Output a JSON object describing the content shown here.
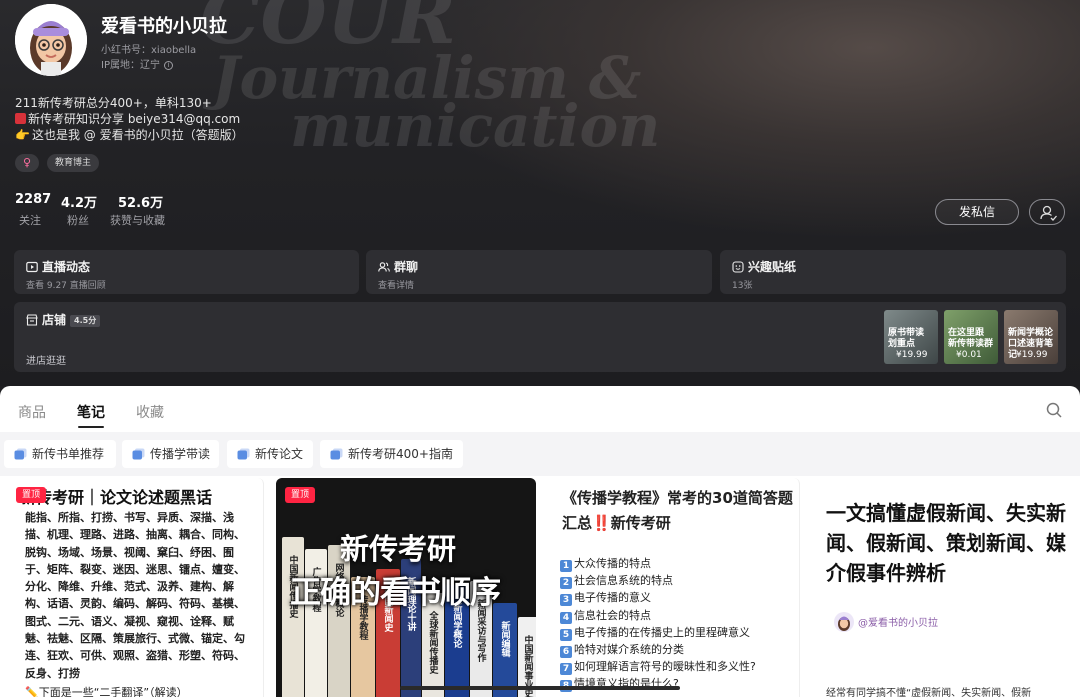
{
  "profile": {
    "name": "爱看书的小贝拉",
    "id_line": "小红书号：xiaobella",
    "ip_line": "IP属地：辽宁",
    "bio": [
      "211新传考研总分400+，单科130+",
      "新传考研知识分享 beiye314@qq.com",
      "这也是我 @ 爱看书的小贝拉（答题版）"
    ],
    "gender_symbol": "♀",
    "category_tag": "教育博主",
    "hero_text": [
      "COUR",
      "Journalism &",
      "munication"
    ]
  },
  "stats": [
    {
      "value": "2287",
      "label": "关注"
    },
    {
      "value": "4.2万",
      "label": "粉丝"
    },
    {
      "value": "52.6万",
      "label": "获赞与收藏"
    }
  ],
  "actions": {
    "message_label": "发私信"
  },
  "features": [
    {
      "title": "直播动态",
      "sub": "查看 9.27 直播回顾",
      "icon": "live-icon"
    },
    {
      "title": "群聊",
      "sub": "查看详情",
      "icon": "group-icon"
    },
    {
      "title": "兴趣贴纸",
      "sub": "13张",
      "icon": "sticker-icon"
    }
  ],
  "shop": {
    "title": "店铺",
    "rating": "4.5分",
    "enter": "进店逛逛",
    "products": [
      {
        "text": "原书带读 划重点",
        "price": "¥19.99"
      },
      {
        "text": "在这里跟 新传带读群",
        "price": "¥0.01"
      },
      {
        "text": "新闻学概论 口述速背笔记",
        "price": "¥19.99"
      }
    ]
  },
  "tabs": [
    "商品",
    "笔记",
    "收藏"
  ],
  "collections": [
    "新传书单推荐",
    "传播学带读",
    "新传论文",
    "新传考研400+指南"
  ],
  "notes": {
    "pin_label": "置顶",
    "n1": {
      "title": "新传考研｜论文论述题黑话",
      "body": "能指、所指、打捞、书写、异质、深描、浅描、机理、理路、进路、抽离、耦合、同构、脱钩、场域、场景、视阈、窠臼、纾困、囿于、矩阵、裂变、迷因、迷思、镭点、嬗变、分化、降维、升维、范式、汲养、建构、解构、话语、灵韵、编码、解码、符码、基模、图式、二元、语义、凝视、窥视、诠释、赋魅、祛魅、区隔、策展旅行、式微、锚定、勾连、狂欢、可供、观照、盗猎、形塑、符码、反身、打捞",
      "foot": "下面是一些“二手翻译”（解读）"
    },
    "n2": {
      "line1": "新传考研",
      "line2": "正确的看书顺序",
      "books": [
        "中国新闻传播史",
        "广告学教程",
        "网络传播概论",
        "传播学教程",
        "外国新闻史",
        "新闻理论十讲",
        "全球新闻传播史",
        "新闻学概论",
        "新闻采访与写作",
        "新闻编辑",
        "中国新闻事业史"
      ]
    },
    "n3": {
      "title_pre": "《传播学教程》常考的30道简答题汇总",
      "title_bang": "‼️",
      "title_post": "新传考研",
      "items": [
        "大众传播的特点",
        "社会信息系统的特点",
        "电子传播的意义",
        "信息社会的特点",
        "电子传播的在传播史上的里程碑意义",
        "哈特对媒介系统的分类",
        "如何理解语言符号的暧昧性和多义性?",
        "情境意义指的是什么?"
      ]
    },
    "n4": {
      "title": "一文搞懂虚假新闻、失实新闻、假新闻、策划新闻、媒介假事件辨析",
      "handle": "@爱看书的小贝拉",
      "foot": "经常有同学搞不懂“虚假新闻、失实新闻、假新"
    }
  }
}
